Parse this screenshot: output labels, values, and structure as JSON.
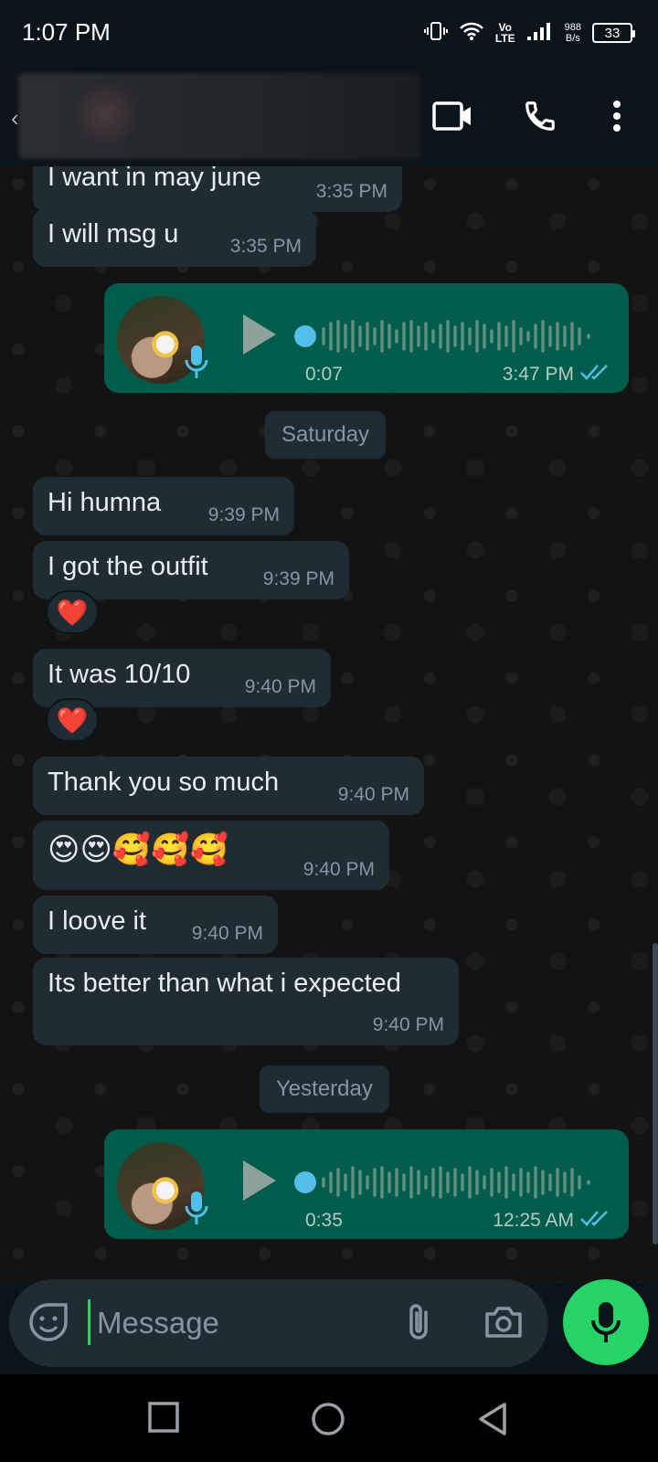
{
  "status_bar": {
    "time": "1:07 PM",
    "volte_top": "Vo",
    "volte_bottom": "LTE",
    "speed_value": "988",
    "speed_unit": "B/s",
    "battery": "33"
  },
  "header": {
    "contact_name": "",
    "video_call_icon": "video-camera",
    "voice_call_icon": "phone",
    "menu_icon": "more-vertical"
  },
  "messages": [
    {
      "text": "I want in may june",
      "time": "3:35 PM"
    },
    {
      "text": "I will msg u",
      "time": "3:35 PM"
    },
    {
      "text": "Hi humna",
      "time": "9:39 PM"
    },
    {
      "text": "I got the outfit",
      "time": "9:39 PM",
      "reaction": "❤️"
    },
    {
      "text": "It was 10/10",
      "time": "9:40 PM",
      "reaction": "❤️"
    },
    {
      "text": "Thank you so much",
      "time": "9:40 PM"
    },
    {
      "text": "😍😍🥰🥰🥰",
      "time": "9:40 PM"
    },
    {
      "text": "I loove it",
      "time": "9:40 PM"
    },
    {
      "text": "Its better than what i expected",
      "time": "9:40 PM"
    }
  ],
  "voice_notes": [
    {
      "duration": "0:07",
      "time": "3:47 PM",
      "status": "read"
    },
    {
      "duration": "0:35",
      "time": "12:25 AM",
      "status": "read"
    }
  ],
  "date_separators": [
    "Saturday",
    "Yesterday"
  ],
  "composer": {
    "placeholder": "Message"
  },
  "colors": {
    "outgoing_bubble": "#005c4b",
    "incoming_bubble": "#1f2c34",
    "accent": "#25d366",
    "read_ticks": "#53bdeb"
  }
}
